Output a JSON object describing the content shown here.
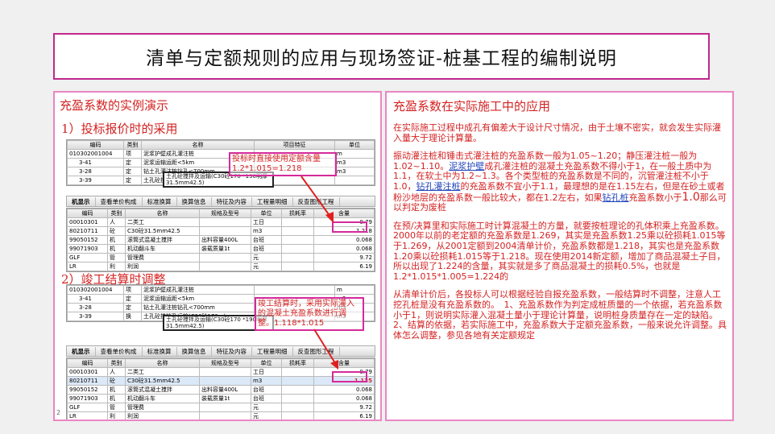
{
  "title": "清单与定额规则的应用与现场签证-桩基工程的编制说明",
  "left": {
    "heading": "充盈系数的实例演示",
    "sub1": "1）投标报价时的采用",
    "sub2": "2）竣工结算时调整",
    "grid_headers": [
      "编码",
      "类别",
      "名称",
      "项目特征",
      "单位"
    ],
    "grid1_rows": [
      [
        "010302001004",
        "项",
        "泥浆护壁成孔灌注桩",
        "",
        "m"
      ],
      [
        "3-41",
        "定",
        "泥浆运输运距<5km",
        "",
        "m3"
      ],
      [
        "3-28",
        "定",
        "钻土孔灌注桩钻孔<700mm",
        "",
        "m3"
      ],
      [
        "3-39",
        "定",
        "土孔砼搅拌及运输(C30砼170...)",
        "",
        ""
      ]
    ],
    "grid2_rows": [
      [
        "010302001004",
        "项",
        "泥浆护壁成孔灌注桩",
        "",
        "m"
      ],
      [
        "3-41",
        "定",
        "泥浆运输运距<5km",
        "",
        "m3"
      ],
      [
        "3-28",
        "定",
        "钻土孔灌注桩钻孔<700mm",
        "",
        "m3"
      ],
      [
        "3-39",
        "换",
        "土孔砼搅拌及运输(C30砼170...)",
        "",
        "m3"
      ]
    ],
    "dark_note1": "土孔砼搅拌及运输(C30砼170 *190明厚31.5mm42.5)",
    "dark_note2": "土孔砼搅拌及运输(C30砼170 *190明厚31.5mm42.5)",
    "tabs": [
      "机显示",
      "查看单价构成",
      "标准换算",
      "换算信息",
      "特征及内容",
      "工程量明细",
      "反查图形工程"
    ],
    "sub_headers": [
      "编码",
      "类别",
      "名称",
      "规格及型号",
      "单位",
      "损耗率",
      "含量"
    ],
    "sub1_rows": [
      [
        "00010301",
        "人",
        "二类工",
        "",
        "工日",
        "",
        "0.79"
      ],
      [
        "80210711",
        "砼",
        "C30砼31.5mm42.5",
        "",
        "m3",
        "",
        "1.218"
      ],
      [
        "99050152",
        "机",
        "滚筒式混凝土搅拌",
        "出料容量400L",
        "台班",
        "",
        "0.068"
      ],
      [
        "99071903",
        "机",
        "机动翻斗车",
        "装载质量1t",
        "台班",
        "",
        "0.068"
      ],
      [
        "GLF",
        "管",
        "管理费",
        "",
        "元",
        "",
        "9.72"
      ],
      [
        "LR",
        "利",
        "利润",
        "",
        "元",
        "",
        "6.19"
      ]
    ],
    "sub2_rows": [
      [
        "00010301",
        "人",
        "二类工",
        "",
        "工日",
        "",
        "0.79"
      ],
      [
        "80210711",
        "砼",
        "C30砼31.5mm42.5",
        "",
        "m3",
        "",
        "1.135"
      ],
      [
        "99050152",
        "机",
        "滚筒式混凝土搅拌",
        "出料容量400L",
        "台班",
        "",
        "0.068"
      ],
      [
        "99071903",
        "机",
        "机动翻斗车",
        "装载质量1t",
        "台班",
        "",
        "0.068"
      ],
      [
        "GLF",
        "管",
        "管理费",
        "",
        "元",
        "",
        "9.72"
      ],
      [
        "LR",
        "利",
        "利润",
        "",
        "元",
        "",
        "6.19"
      ]
    ],
    "callout1": "投标时直接使用定额含量 1.2*1.015=1.218",
    "callout2": "竣工结算时，采用实际灌入的混凝土充盈系数进行调整。1.118*1.015",
    "highlight1": "1.218",
    "highlight2": "1.135",
    "page_num": "2"
  },
  "right": {
    "heading": "充盈系数在实际施工中的应用",
    "p1": "在实际施工过程中成孔有偏差大于设计尺寸情况，由于土壤不密实，就会发生实际灌入量大于理论计算量。",
    "p2a": "振动灌注桩和锤击式灌注桩的充盈系数一般为1.05~1.20；静压灌注桩一般为1.02~1.10。",
    "p2_link1": "泥浆护壁",
    "p2b": "成孔灌注桩的混凝土充盈系数不得小于1，在一般土质中为1.1，在软土中为1.2~1.3。各个类型桩的充盈系数是不同的，沉管灌注桩不小于1.0，",
    "p2_link2": "钻孔灌注桩",
    "p2c": "的充盈系数不宜小于1.1，最理想的是在1.15左右，但是在砂土或者粉沙地层的充盈系数一般比较大，都在1.2左右，如果",
    "p2_link3": "钻孔桩",
    "p2d": "充盈系数小于",
    "p2_big": "1.0",
    "p2e": "那么可以判定为废桩",
    "p3": "在预/决算里和实际施工时计算混凝土的方量，就要按桩理论的孔体积乘上充盈系数。2000年以前的老定额的充盈系数是1.269，其实是充盈系数1.25乘以砼损耗1.015等于1.269，从2001定额到2004清单计价，充盈系数都是1.218，其实也是充盈系数1.20乘以砼损耗1.015等于1.218。现在使用2014新定额，增加了商品混凝土子目，所以出现了1.224的含量，其实就是多了商品混凝土的损耗0.5%，也就是1.2*1.015*1.005=1.224的",
    "p4": "从清单计价后，各投标人可以根据经验自报充盈系数，一般结算时不调整，注意人工挖孔桩是没有充盈系数的。　1、充盈系数作为判定成桩质量的一个依据，若充盈系数小于1，则说明实际灌入混凝土量小于理论计算量，说明桩身质量存在一定的缺陷。　　2、结算的依据，若实际施工中，充盈系数大于定额充盈系数，一般来说允许调整。具体怎么调整，参见各地有关定额规定"
  }
}
